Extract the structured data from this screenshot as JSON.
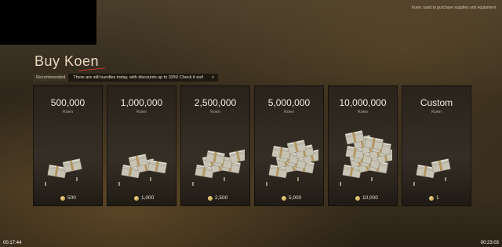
{
  "top_hint": "Koen: used to purchase supplies and equipment",
  "title": "Buy Koen",
  "banner": {
    "tag": "Recommended",
    "message": "There are still bundles today, with discounts up to 33%! Check it out!",
    "chevron": ">"
  },
  "cards": [
    {
      "amount": "500,000",
      "unit": "Koen",
      "price": "500",
      "stacks": 2
    },
    {
      "amount": "1,000,000",
      "unit": "Koen",
      "price": "1,000",
      "stacks": 4
    },
    {
      "amount": "2,500,000",
      "unit": "Koen",
      "price": "2,500",
      "stacks": 7
    },
    {
      "amount": "5,000,000",
      "unit": "Koen",
      "price": "5,000",
      "stacks": 10
    },
    {
      "amount": "10,000,000",
      "unit": "Koen",
      "price": "10,000",
      "stacks": 14
    },
    {
      "amount": "Custom",
      "unit": "Koen",
      "price": "1",
      "stacks": 2
    }
  ],
  "timers": {
    "left": "00:17:44",
    "right": "00:23:03"
  },
  "colors": {
    "accent_underline": "#c0392b",
    "coin": "#d9b45a",
    "banknote": "#d8d6c8"
  },
  "icons": {
    "currency": "coin-icon",
    "art": "banknote-stack-icon"
  }
}
